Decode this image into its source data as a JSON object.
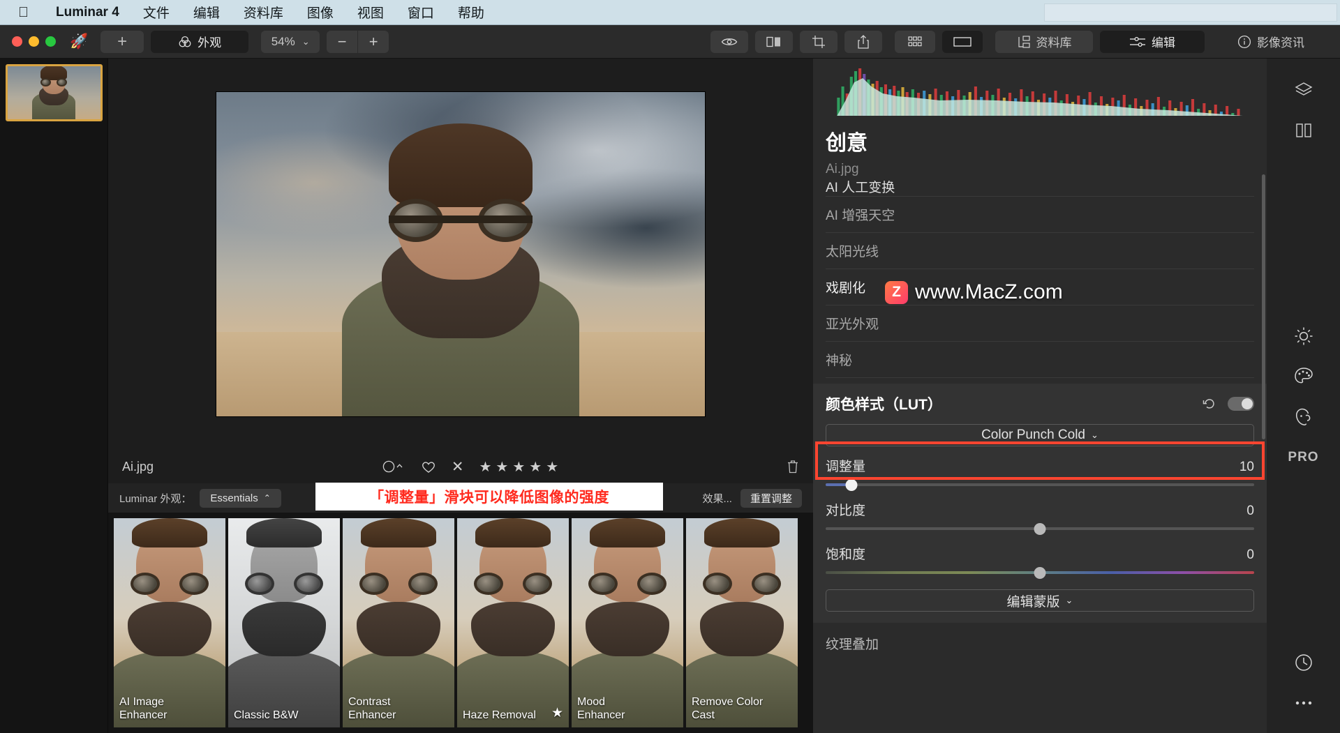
{
  "menubar": {
    "apple_icon": "apple-logo",
    "items": [
      {
        "label": "Luminar 4",
        "bold": true
      },
      {
        "label": "文件"
      },
      {
        "label": "编辑"
      },
      {
        "label": "资料库"
      },
      {
        "label": "图像"
      },
      {
        "label": "视图"
      },
      {
        "label": "窗口"
      },
      {
        "label": "帮助"
      }
    ]
  },
  "toolbar": {
    "add_label": "+",
    "looks_label": "外观",
    "looks_icon": "venn-circles-icon",
    "zoom_value": "54%",
    "zoom_caret": "⌄",
    "minus_label": "−",
    "plus_label": "+",
    "icons": {
      "preview": "eye-icon",
      "compare": "split-compare-icon",
      "crop": "crop-icon",
      "share": "share-icon",
      "grid": "grid-icon",
      "single": "single-view-icon"
    },
    "tabs": [
      {
        "label": "资料库",
        "icon": "library-icon",
        "active": false
      },
      {
        "label": "编辑",
        "icon": "sliders-icon",
        "active": true
      },
      {
        "label": "影像资讯",
        "icon": "info-icon",
        "active": false
      }
    ]
  },
  "canvas": {
    "filename": "Ai.jpg"
  },
  "infobar": {
    "filename": "Ai.jpg",
    "color_label_icon": "circle-caret-icon",
    "favorite_icon": "heart-icon",
    "reject_icon": "x-icon",
    "stars": [
      "★",
      "★",
      "★",
      "★",
      "★"
    ],
    "star_count": 0,
    "trash_icon": "trash-icon"
  },
  "looksbar": {
    "label": "Luminar 外观：",
    "collection": "Essentials",
    "collection_caret": "⌃",
    "effects_link": "效果...",
    "reset_label": "重置调整"
  },
  "presets": [
    {
      "label": "AI Image\nEnhancer",
      "starred": false,
      "bw": false
    },
    {
      "label": "Classic B&W",
      "starred": false,
      "bw": true
    },
    {
      "label": "Contrast\nEnhancer",
      "starred": false,
      "bw": false
    },
    {
      "label": "Haze Removal",
      "starred": true,
      "bw": false
    },
    {
      "label": "Mood\nEnhancer",
      "starred": false,
      "bw": false
    },
    {
      "label": "Remove Color\nCast",
      "starred": false,
      "bw": false
    }
  ],
  "annotation": {
    "text": "「调整量」滑块可以降低图像的强度",
    "color": "#ff2a1e",
    "background": "#ffffff"
  },
  "watermark": {
    "badge": "Z",
    "text": "www.MacZ.com"
  },
  "rightpanel": {
    "title": "创意",
    "filename": "Ai.jpg",
    "tools": [
      {
        "label": "AI 人工变换",
        "clipped": true
      },
      {
        "label": "AI 增强天空"
      },
      {
        "label": "太阳光线"
      },
      {
        "label": "戏剧化",
        "active": true
      },
      {
        "label": "亚光外观"
      },
      {
        "label": "神秘"
      }
    ],
    "lut": {
      "title": "颜色样式（LUT）",
      "undo_icon": "undo-icon",
      "toggle_icon": "toggle-on-icon",
      "preset": "Color Punch Cold",
      "preset_caret": "⌄",
      "sliders": [
        {
          "name": "调整量",
          "value": "10",
          "pct": 10,
          "highlighted": true,
          "type": "blue"
        },
        {
          "name": "对比度",
          "value": "0",
          "pct": 50,
          "highlighted": false,
          "type": "grey"
        },
        {
          "name": "饱和度",
          "value": "0",
          "pct": 50,
          "highlighted": false,
          "type": "saturation"
        }
      ],
      "mask_button": "编辑蒙版",
      "mask_caret": "⌄"
    },
    "next_section": "纹理叠加"
  },
  "rail": {
    "items": [
      {
        "icon": "layers-icon"
      },
      {
        "icon": "compare-panels-icon"
      },
      {
        "icon": "sun-icon"
      },
      {
        "icon": "palette-icon"
      },
      {
        "icon": "portrait-icon"
      },
      {
        "icon": "pro-icon",
        "label": "PRO"
      },
      {
        "icon": "history-icon"
      },
      {
        "icon": "more-icon"
      }
    ]
  },
  "histogram": {
    "label": "histogram"
  }
}
